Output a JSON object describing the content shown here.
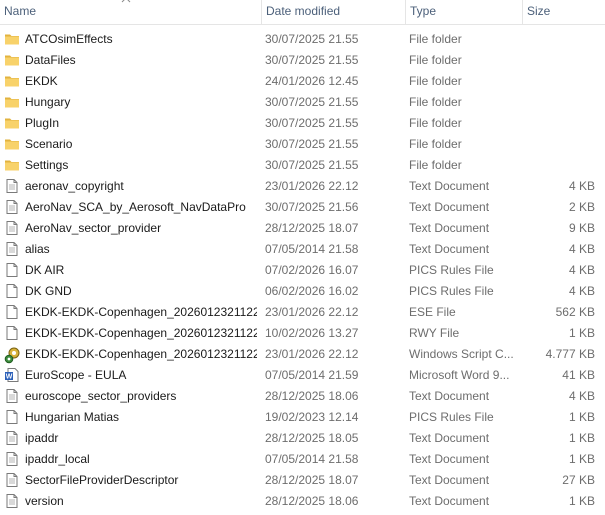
{
  "columns": {
    "name": "Name",
    "date": "Date modified",
    "type": "Type",
    "size": "Size"
  },
  "rows": [
    {
      "name": "ATCOsimEffects",
      "date": "30/07/2025 21.55",
      "type": "File folder",
      "size": "",
      "icon": "folder-icon"
    },
    {
      "name": "DataFiles",
      "date": "30/07/2025 21.55",
      "type": "File folder",
      "size": "",
      "icon": "folder-icon"
    },
    {
      "name": "EKDK",
      "date": "24/01/2026 12.45",
      "type": "File folder",
      "size": "",
      "icon": "folder-icon"
    },
    {
      "name": "Hungary",
      "date": "30/07/2025 21.55",
      "type": "File folder",
      "size": "",
      "icon": "folder-icon"
    },
    {
      "name": "PlugIn",
      "date": "30/07/2025 21.55",
      "type": "File folder",
      "size": "",
      "icon": "folder-icon"
    },
    {
      "name": "Scenario",
      "date": "30/07/2025 21.55",
      "type": "File folder",
      "size": "",
      "icon": "folder-icon"
    },
    {
      "name": "Settings",
      "date": "30/07/2025 21.55",
      "type": "File folder",
      "size": "",
      "icon": "folder-icon"
    },
    {
      "name": "aeronav_copyright",
      "date": "23/01/2026 22.12",
      "type": "Text Document",
      "size": "4 KB",
      "icon": "text-document-icon"
    },
    {
      "name": "AeroNav_SCA_by_Aerosoft_NavDataPro",
      "date": "30/07/2025 21.56",
      "type": "Text Document",
      "size": "2 KB",
      "icon": "text-document-icon"
    },
    {
      "name": "AeroNav_sector_provider",
      "date": "28/12/2025 18.07",
      "type": "Text Document",
      "size": "9 KB",
      "icon": "text-document-icon"
    },
    {
      "name": "alias",
      "date": "07/05/2014 21.58",
      "type": "Text Document",
      "size": "4 KB",
      "icon": "text-document-icon"
    },
    {
      "name": "DK AIR",
      "date": "07/02/2026 16.07",
      "type": "PICS Rules File",
      "size": "4 KB",
      "icon": "blank-file-icon"
    },
    {
      "name": "DK GND",
      "date": "06/02/2026 16.02",
      "type": "PICS Rules File",
      "size": "4 KB",
      "icon": "blank-file-icon"
    },
    {
      "name": "EKDK-EKDK-Copenhagen_2026012321122...",
      "date": "23/01/2026 22.12",
      "type": "ESE File",
      "size": "562 KB",
      "icon": "blank-file-icon"
    },
    {
      "name": "EKDK-EKDK-Copenhagen_2026012321122...",
      "date": "10/02/2026 13.27",
      "type": "RWY File",
      "size": "1 KB",
      "icon": "blank-file-icon"
    },
    {
      "name": "EKDK-EKDK-Copenhagen_2026012321122...",
      "date": "23/01/2026 22.12",
      "type": "Windows Script C...",
      "size": "4.777 KB",
      "icon": "script-gear-icon"
    },
    {
      "name": "EuroScope - EULA",
      "date": "07/05/2014 21.59",
      "type": "Microsoft Word 9...",
      "size": "41 KB",
      "icon": "word-document-icon"
    },
    {
      "name": "euroscope_sector_providers",
      "date": "28/12/2025 18.06",
      "type": "Text Document",
      "size": "4 KB",
      "icon": "text-document-icon"
    },
    {
      "name": "Hungarian Matias",
      "date": "19/02/2023 12.14",
      "type": "PICS Rules File",
      "size": "1 KB",
      "icon": "blank-file-icon"
    },
    {
      "name": "ipaddr",
      "date": "28/12/2025 18.05",
      "type": "Text Document",
      "size": "1 KB",
      "icon": "text-document-icon"
    },
    {
      "name": "ipaddr_local",
      "date": "07/05/2014 21.58",
      "type": "Text Document",
      "size": "1 KB",
      "icon": "text-document-icon"
    },
    {
      "name": "SectorFileProviderDescriptor",
      "date": "28/12/2025 18.07",
      "type": "Text Document",
      "size": "27 KB",
      "icon": "text-document-icon"
    },
    {
      "name": "version",
      "date": "28/12/2025 18.06",
      "type": "Text Document",
      "size": "1 KB",
      "icon": "text-document-icon"
    }
  ],
  "colors": {
    "header_text": "#4c607a",
    "folder": "#f8d26a",
    "folder_dark": "#e2b33f",
    "secondary_text": "#6d6d6d"
  }
}
